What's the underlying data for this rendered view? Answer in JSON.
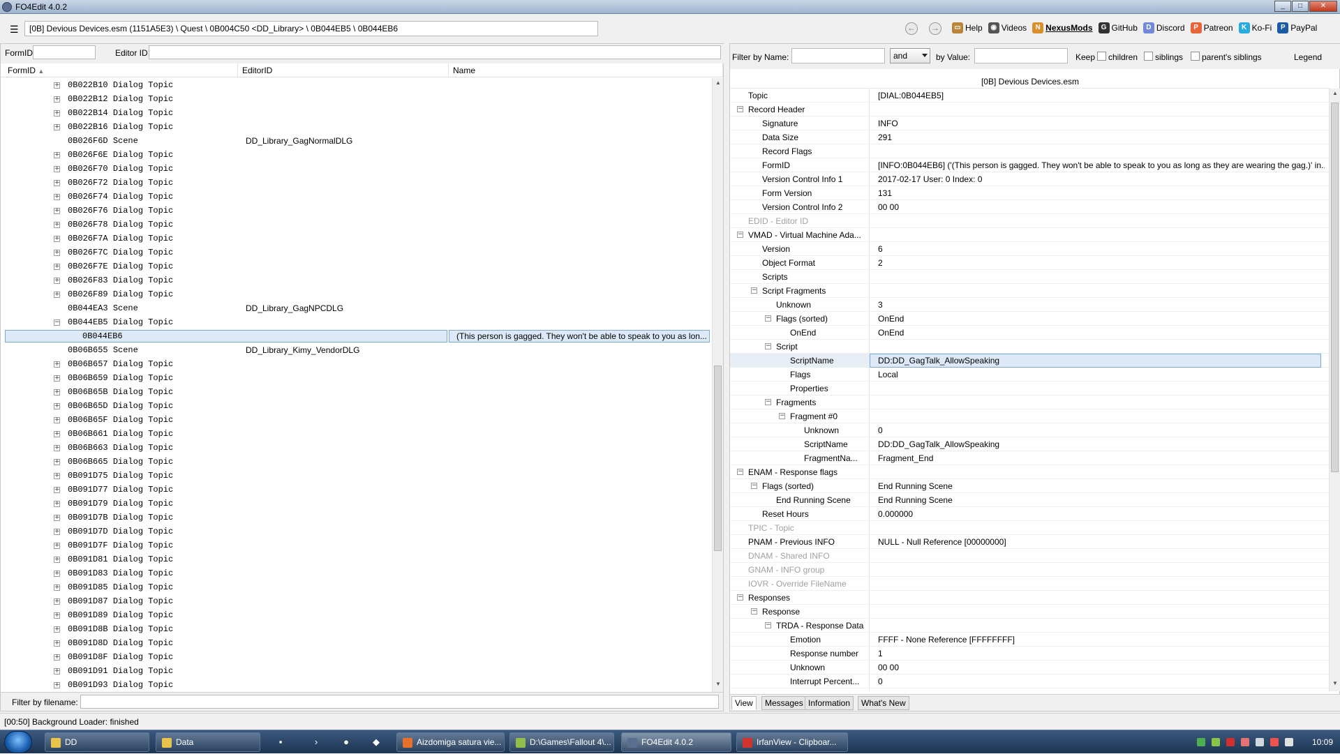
{
  "window": {
    "title": "FO4Edit 4.0.2",
    "minimize": "_",
    "maximize": "□",
    "close": "✕"
  },
  "toolbar": {
    "path": "[0B] Devious Devices.esm (1151A5E3) \\ Quest \\ 0B004C50 <DD_Library> \\ 0B044EB5 \\ 0B044EB6",
    "back": "←",
    "forward": "→",
    "links": [
      {
        "label": "Help",
        "icon": "book-icon",
        "color": "#b8863b",
        "glyph": "▭"
      },
      {
        "label": "Videos",
        "icon": "film-icon",
        "color": "#555555",
        "glyph": "◉"
      },
      {
        "label": "NexusMods",
        "icon": "nexusmods-icon",
        "color": "#d98f2b",
        "glyph": "N"
      },
      {
        "label": "GitHub",
        "icon": "github-icon",
        "color": "#333333",
        "glyph": "G"
      },
      {
        "label": "Discord",
        "icon": "discord-icon",
        "color": "#7289da",
        "glyph": "D"
      },
      {
        "label": "Patreon",
        "icon": "patreon-icon",
        "color": "#e8643a",
        "glyph": "P"
      },
      {
        "label": "Ko-Fi",
        "icon": "kofi-icon",
        "color": "#29abe0",
        "glyph": "K"
      },
      {
        "label": "PayPal",
        "icon": "paypal-icon",
        "color": "#1c5aa6",
        "glyph": "P"
      }
    ]
  },
  "left": {
    "formid_label": "FormID",
    "editorid_label": "Editor ID",
    "columns": [
      "FormID",
      "EditorID",
      "Name"
    ],
    "sort_arrow": "▲",
    "rows": [
      {
        "fid": "0B022B10",
        "type": "Dialog Topic",
        "edid": "",
        "name": "",
        "exp": "+"
      },
      {
        "fid": "0B022B12",
        "type": "Dialog Topic",
        "edid": "",
        "name": "",
        "exp": "+"
      },
      {
        "fid": "0B022B14",
        "type": "Dialog Topic",
        "edid": "",
        "name": "",
        "exp": "+"
      },
      {
        "fid": "0B022B16",
        "type": "Dialog Topic",
        "edid": "",
        "name": "",
        "exp": "+"
      },
      {
        "fid": "0B026F6D",
        "type": "Scene",
        "edid": "DD_Library_GagNormalDLG",
        "name": "",
        "exp": ""
      },
      {
        "fid": "0B026F6E",
        "type": "Dialog Topic",
        "edid": "",
        "name": "",
        "exp": "+"
      },
      {
        "fid": "0B026F70",
        "type": "Dialog Topic",
        "edid": "",
        "name": "",
        "exp": "+"
      },
      {
        "fid": "0B026F72",
        "type": "Dialog Topic",
        "edid": "",
        "name": "",
        "exp": "+"
      },
      {
        "fid": "0B026F74",
        "type": "Dialog Topic",
        "edid": "",
        "name": "",
        "exp": "+"
      },
      {
        "fid": "0B026F76",
        "type": "Dialog Topic",
        "edid": "",
        "name": "",
        "exp": "+"
      },
      {
        "fid": "0B026F78",
        "type": "Dialog Topic",
        "edid": "",
        "name": "",
        "exp": "+"
      },
      {
        "fid": "0B026F7A",
        "type": "Dialog Topic",
        "edid": "",
        "name": "",
        "exp": "+"
      },
      {
        "fid": "0B026F7C",
        "type": "Dialog Topic",
        "edid": "",
        "name": "",
        "exp": "+"
      },
      {
        "fid": "0B026F7E",
        "type": "Dialog Topic",
        "edid": "",
        "name": "",
        "exp": "+"
      },
      {
        "fid": "0B026F83",
        "type": "Dialog Topic",
        "edid": "",
        "name": "",
        "exp": "+"
      },
      {
        "fid": "0B026F89",
        "type": "Dialog Topic",
        "edid": "",
        "name": "",
        "exp": "+"
      },
      {
        "fid": "0B044EA3",
        "type": "Scene",
        "edid": "DD_Library_GagNPCDLG",
        "name": "",
        "exp": ""
      },
      {
        "fid": "0B044EB5",
        "type": "Dialog Topic",
        "edid": "",
        "name": "",
        "exp": "−"
      },
      {
        "fid": "0B044EB6",
        "type": "",
        "edid": "",
        "name": "(This person is gagged. They won't be able to speak to you as lon...",
        "exp": "",
        "child": true,
        "selected": true
      },
      {
        "fid": "0B06B655",
        "type": "Scene",
        "edid": "DD_Library_Kimy_VendorDLG",
        "name": "",
        "exp": ""
      },
      {
        "fid": "0B06B657",
        "type": "Dialog Topic",
        "edid": "",
        "name": "",
        "exp": "+"
      },
      {
        "fid": "0B06B659",
        "type": "Dialog Topic",
        "edid": "",
        "name": "",
        "exp": "+"
      },
      {
        "fid": "0B06B65B",
        "type": "Dialog Topic",
        "edid": "",
        "name": "",
        "exp": "+"
      },
      {
        "fid": "0B06B65D",
        "type": "Dialog Topic",
        "edid": "",
        "name": "",
        "exp": "+"
      },
      {
        "fid": "0B06B65F",
        "type": "Dialog Topic",
        "edid": "",
        "name": "",
        "exp": "+"
      },
      {
        "fid": "0B06B661",
        "type": "Dialog Topic",
        "edid": "",
        "name": "",
        "exp": "+"
      },
      {
        "fid": "0B06B663",
        "type": "Dialog Topic",
        "edid": "",
        "name": "",
        "exp": "+"
      },
      {
        "fid": "0B06B665",
        "type": "Dialog Topic",
        "edid": "",
        "name": "",
        "exp": "+"
      },
      {
        "fid": "0B091D75",
        "type": "Dialog Topic",
        "edid": "",
        "name": "",
        "exp": "+"
      },
      {
        "fid": "0B091D77",
        "type": "Dialog Topic",
        "edid": "",
        "name": "",
        "exp": "+"
      },
      {
        "fid": "0B091D79",
        "type": "Dialog Topic",
        "edid": "",
        "name": "",
        "exp": "+"
      },
      {
        "fid": "0B091D7B",
        "type": "Dialog Topic",
        "edid": "",
        "name": "",
        "exp": "+"
      },
      {
        "fid": "0B091D7D",
        "type": "Dialog Topic",
        "edid": "",
        "name": "",
        "exp": "+"
      },
      {
        "fid": "0B091D7F",
        "type": "Dialog Topic",
        "edid": "",
        "name": "",
        "exp": "+"
      },
      {
        "fid": "0B091D81",
        "type": "Dialog Topic",
        "edid": "",
        "name": "",
        "exp": "+"
      },
      {
        "fid": "0B091D83",
        "type": "Dialog Topic",
        "edid": "",
        "name": "",
        "exp": "+"
      },
      {
        "fid": "0B091D85",
        "type": "Dialog Topic",
        "edid": "",
        "name": "",
        "exp": "+"
      },
      {
        "fid": "0B091D87",
        "type": "Dialog Topic",
        "edid": "",
        "name": "",
        "exp": "+"
      },
      {
        "fid": "0B091D89",
        "type": "Dialog Topic",
        "edid": "",
        "name": "",
        "exp": "+"
      },
      {
        "fid": "0B091D8B",
        "type": "Dialog Topic",
        "edid": "",
        "name": "",
        "exp": "+"
      },
      {
        "fid": "0B091D8D",
        "type": "Dialog Topic",
        "edid": "",
        "name": "",
        "exp": "+"
      },
      {
        "fid": "0B091D8F",
        "type": "Dialog Topic",
        "edid": "",
        "name": "",
        "exp": "+"
      },
      {
        "fid": "0B091D91",
        "type": "Dialog Topic",
        "edid": "",
        "name": "",
        "exp": "+"
      },
      {
        "fid": "0B091D93",
        "type": "Dialog Topic",
        "edid": "",
        "name": "",
        "exp": "+"
      }
    ],
    "filter_filename_label": "Filter by filename:"
  },
  "right": {
    "filter_name_label": "Filter by Name:",
    "and_value": "and",
    "by_value_label": "by Value:",
    "keep_label": "Keep",
    "children_label": "children",
    "siblings_label": "siblings",
    "parents_siblings_label": "parent's siblings",
    "legend_label": "Legend",
    "header": "[0B] Devious Devices.esm",
    "rows": [
      {
        "key": "Topic",
        "value": "[DIAL:0B044EB5]",
        "level": 0,
        "exp": ""
      },
      {
        "key": "Record Header",
        "value": "",
        "level": 0,
        "exp": "−"
      },
      {
        "key": "Signature",
        "value": "INFO",
        "level": 1,
        "exp": ""
      },
      {
        "key": "Data Size",
        "value": "291",
        "level": 1,
        "exp": ""
      },
      {
        "key": "Record Flags",
        "value": "",
        "level": 1,
        "exp": ""
      },
      {
        "key": "FormID",
        "value": "[INFO:0B044EB6] ('(This person is gagged. They won't be able to speak to you as long as they are wearing the gag.)' in...",
        "level": 1,
        "exp": ""
      },
      {
        "key": "Version Control Info 1",
        "value": "2017-02-17 User: 0 Index: 0",
        "level": 1,
        "exp": ""
      },
      {
        "key": "Form Version",
        "value": "131",
        "level": 1,
        "exp": ""
      },
      {
        "key": "Version Control Info 2",
        "value": "00 00",
        "level": 1,
        "exp": ""
      },
      {
        "key": "EDID - Editor ID",
        "value": "",
        "level": 0,
        "exp": "",
        "grey": true
      },
      {
        "key": "VMAD - Virtual Machine Ada...",
        "value": "",
        "level": 0,
        "exp": "−"
      },
      {
        "key": "Version",
        "value": "6",
        "level": 1,
        "exp": ""
      },
      {
        "key": "Object Format",
        "value": "2",
        "level": 1,
        "exp": ""
      },
      {
        "key": "Scripts",
        "value": "",
        "level": 1,
        "exp": ""
      },
      {
        "key": "Script Fragments",
        "value": "",
        "level": 1,
        "exp": "−"
      },
      {
        "key": "Unknown",
        "value": "3",
        "level": 2,
        "exp": ""
      },
      {
        "key": "Flags (sorted)",
        "value": "OnEnd",
        "level": 2,
        "exp": "−"
      },
      {
        "key": "OnEnd",
        "value": "OnEnd",
        "level": 3,
        "exp": ""
      },
      {
        "key": "Script",
        "value": "",
        "level": 2,
        "exp": "−"
      },
      {
        "key": "ScriptName",
        "value": "DD:DD_GagTalk_AllowSpeaking",
        "level": 3,
        "exp": "",
        "selected": true
      },
      {
        "key": "Flags",
        "value": "Local",
        "level": 3,
        "exp": ""
      },
      {
        "key": "Properties",
        "value": "",
        "level": 3,
        "exp": ""
      },
      {
        "key": "Fragments",
        "value": "",
        "level": 2,
        "exp": "−"
      },
      {
        "key": "Fragment #0",
        "value": "",
        "level": 3,
        "exp": "−"
      },
      {
        "key": "Unknown",
        "value": "0",
        "level": 4,
        "exp": ""
      },
      {
        "key": "ScriptName",
        "value": "DD:DD_GagTalk_AllowSpeaking",
        "level": 4,
        "exp": ""
      },
      {
        "key": "FragmentNa...",
        "value": "Fragment_End",
        "level": 4,
        "exp": ""
      },
      {
        "key": "ENAM - Response flags",
        "value": "",
        "level": 0,
        "exp": "−"
      },
      {
        "key": "Flags (sorted)",
        "value": "End Running Scene",
        "level": 1,
        "exp": "−"
      },
      {
        "key": "End Running Scene",
        "value": "End Running Scene",
        "level": 2,
        "exp": ""
      },
      {
        "key": "Reset Hours",
        "value": "0.000000",
        "level": 1,
        "exp": ""
      },
      {
        "key": "TPIC - Topic",
        "value": "",
        "level": 0,
        "exp": "",
        "grey": true
      },
      {
        "key": "PNAM - Previous INFO",
        "value": "NULL - Null Reference [00000000]",
        "level": 0,
        "exp": ""
      },
      {
        "key": "DNAM - Shared INFO",
        "value": "",
        "level": 0,
        "exp": "",
        "grey": true
      },
      {
        "key": "GNAM - INFO group",
        "value": "",
        "level": 0,
        "exp": "",
        "grey": true
      },
      {
        "key": "IOVR - Override FileName",
        "value": "",
        "level": 0,
        "exp": "",
        "grey": true
      },
      {
        "key": "Responses",
        "value": "",
        "level": 0,
        "exp": "−"
      },
      {
        "key": "Response",
        "value": "",
        "level": 1,
        "exp": "−"
      },
      {
        "key": "TRDA - Response Data",
        "value": "",
        "level": 2,
        "exp": "−"
      },
      {
        "key": "Emotion",
        "value": "FFFF - None Reference [FFFFFFFF]",
        "level": 3,
        "exp": ""
      },
      {
        "key": "Response number",
        "value": "1",
        "level": 3,
        "exp": ""
      },
      {
        "key": "Unknown",
        "value": "00 00",
        "level": 3,
        "exp": ""
      },
      {
        "key": "Interrupt Percent...",
        "value": "0",
        "level": 3,
        "exp": ""
      }
    ],
    "tabs": [
      "View",
      "Messages",
      "Information",
      "What's New"
    ]
  },
  "status": {
    "text": "[00:50] Background Loader: finished"
  },
  "taskbar": {
    "buttons": [
      {
        "label": "DD",
        "color": "#e8c24a"
      },
      {
        "label": "Data",
        "color": "#e8c24a"
      },
      {
        "label": "Aizdomiga satura vie...",
        "color": "#e8702a"
      },
      {
        "label": "D:\\Games\\Fallout 4\\...",
        "color": "#8fbf4a"
      },
      {
        "label": "FO4Edit 4.0.2",
        "color": "#5a6f8f"
      },
      {
        "label": "IrfanView - Clipboar...",
        "color": "#d0342c"
      }
    ],
    "clock": "10:09"
  }
}
